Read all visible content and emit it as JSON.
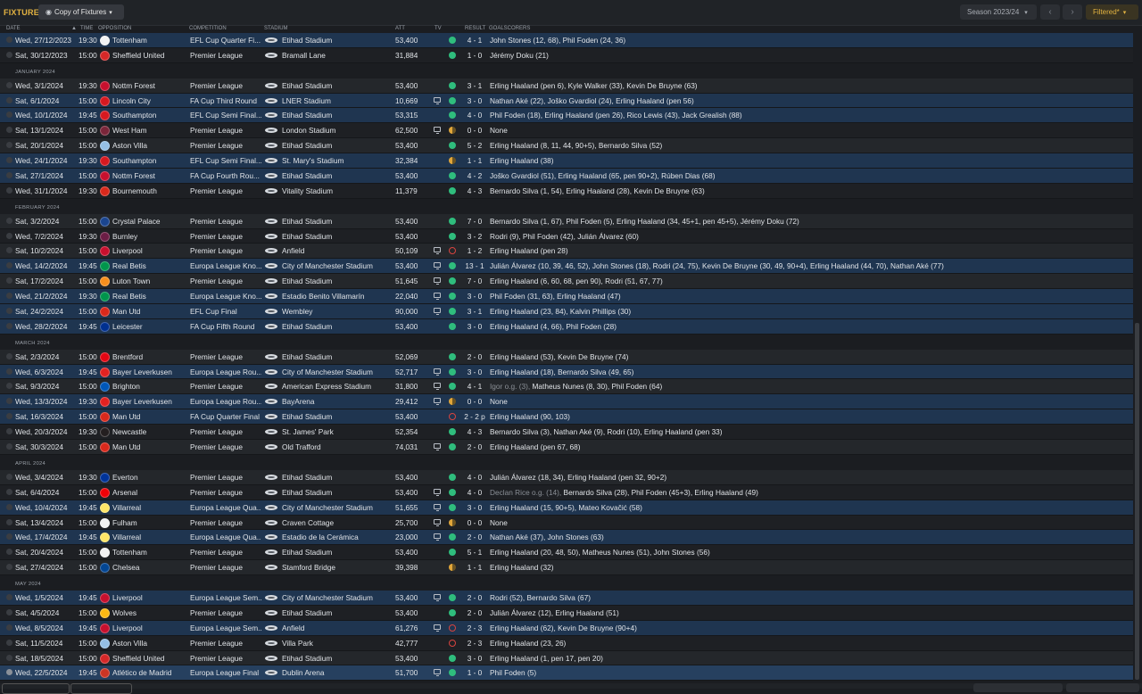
{
  "header": {
    "title": "FIXTURES",
    "view_button": "Copy of Fixtures",
    "season": "Season 2023/24",
    "filter_button": "Filtered*"
  },
  "columns": {
    "date": "DATE",
    "time": "TIME",
    "opposition": "OPPOSITION",
    "competition": "COMPETITION",
    "stadium": "STADIUM",
    "att": "ATT",
    "tv": "TV",
    "result": "RESULT",
    "goalscorers": "GOALSCORERS"
  },
  "colors": {
    "accent": "#e3b341",
    "win": "#2fbd7d",
    "loss": "#d9443f",
    "draw": "#e0a63a",
    "row_highlight": "#1f3550"
  },
  "rows": [
    {
      "type": "match",
      "date": "Wed, 27/12/2023",
      "time": "19:30",
      "opp": "Tottenham",
      "crest": "#f2f2f2",
      "comp": "EFL Cup Quarter Fi...",
      "stadium": "Etihad Stadium",
      "att": "53,400",
      "tv": false,
      "res": "win",
      "score": "4 - 1",
      "scorers": "John Stones (12, 68), Phil Foden (24, 36)",
      "hl": true
    },
    {
      "type": "match",
      "date": "Sat, 30/12/2023",
      "time": "15:00",
      "opp": "Sheffield United",
      "crest": "#d62828",
      "comp": "Premier League",
      "stadium": "Bramall Lane",
      "att": "31,884",
      "tv": false,
      "res": "win",
      "score": "1 - 0",
      "scorers": "Jérémy Doku (21)",
      "hl": false
    },
    {
      "type": "section",
      "label": "JANUARY 2024"
    },
    {
      "type": "match",
      "date": "Wed, 3/1/2024",
      "time": "19:30",
      "opp": "Nottm Forest",
      "crest": "#c8102e",
      "comp": "Premier League",
      "stadium": "Etihad Stadium",
      "att": "53,400",
      "tv": false,
      "res": "win",
      "score": "3 - 1",
      "scorers": "Erling Haaland (pen 6), Kyle Walker (33), Kevin De Bruyne (63)",
      "hl": false
    },
    {
      "type": "match",
      "date": "Sat, 6/1/2024",
      "time": "15:00",
      "opp": "Lincoln City",
      "crest": "#d71920",
      "comp": "FA Cup Third Round",
      "stadium": "LNER Stadium",
      "att": "10,669",
      "tv": true,
      "res": "win",
      "score": "3 - 0",
      "scorers": "Nathan Aké (22), Joško Gvardiol (24), Erling Haaland (pen 56)",
      "hl": true
    },
    {
      "type": "match",
      "date": "Wed, 10/1/2024",
      "time": "19:45",
      "opp": "Southampton",
      "crest": "#d71920",
      "comp": "EFL Cup Semi Final...",
      "stadium": "Etihad Stadium",
      "att": "53,315",
      "tv": false,
      "res": "win",
      "score": "4 - 0",
      "scorers": "Phil Foden (18), Erling Haaland (pen 26), Rico Lewis (43), Jack Grealish (88)",
      "hl": true
    },
    {
      "type": "match",
      "date": "Sat, 13/1/2024",
      "time": "15:00",
      "opp": "West Ham",
      "crest": "#7a263a",
      "comp": "Premier League",
      "stadium": "London Stadium",
      "att": "62,500",
      "tv": true,
      "res": "draw",
      "score": "0 - 0",
      "scorers": "None",
      "hl": false
    },
    {
      "type": "match",
      "date": "Sat, 20/1/2024",
      "time": "15:00",
      "opp": "Aston Villa",
      "crest": "#95bfe5",
      "comp": "Premier League",
      "stadium": "Etihad Stadium",
      "att": "53,400",
      "tv": false,
      "res": "win",
      "score": "5 - 2",
      "scorers": "Erling Haaland (8, 11, 44, 90+5), Bernardo Silva (52)",
      "hl": false
    },
    {
      "type": "match",
      "date": "Wed, 24/1/2024",
      "time": "19:30",
      "opp": "Southampton",
      "crest": "#d71920",
      "comp": "EFL Cup Semi Final...",
      "stadium": "St. Mary's Stadium",
      "att": "32,384",
      "tv": false,
      "res": "draw",
      "score": "1 - 1",
      "scorers": "Erling Haaland (38)",
      "hl": true
    },
    {
      "type": "match",
      "date": "Sat, 27/1/2024",
      "time": "15:00",
      "opp": "Nottm Forest",
      "crest": "#c8102e",
      "comp": "FA Cup Fourth Rou...",
      "stadium": "Etihad Stadium",
      "att": "53,400",
      "tv": false,
      "res": "win",
      "score": "4 - 2",
      "scorers": "Joško Gvardiol (51), Erling Haaland (65, pen 90+2), Rúben Dias (68)",
      "hl": true
    },
    {
      "type": "match",
      "date": "Wed, 31/1/2024",
      "time": "19:30",
      "opp": "Bournemouth",
      "crest": "#da291c",
      "comp": "Premier League",
      "stadium": "Vitality Stadium",
      "att": "11,379",
      "tv": false,
      "res": "win",
      "score": "4 - 3",
      "scorers": "Bernardo Silva (1, 54), Erling Haaland (28), Kevin De Bruyne (63)",
      "hl": false
    },
    {
      "type": "section",
      "label": "FEBRUARY 2024"
    },
    {
      "type": "match",
      "date": "Sat, 3/2/2024",
      "time": "15:00",
      "opp": "Crystal Palace",
      "crest": "#1b458f",
      "comp": "Premier League",
      "stadium": "Etihad Stadium",
      "att": "53,400",
      "tv": false,
      "res": "win",
      "score": "7 - 0",
      "scorers": "Bernardo Silva (1, 67), Phil Foden (5), Erling Haaland (34, 45+1, pen 45+5), Jérémy Doku (72)",
      "hl": false
    },
    {
      "type": "match",
      "date": "Wed, 7/2/2024",
      "time": "19:30",
      "opp": "Burnley",
      "crest": "#6c1d45",
      "comp": "Premier League",
      "stadium": "Etihad Stadium",
      "att": "53,400",
      "tv": false,
      "res": "win",
      "score": "3 - 2",
      "scorers": "Rodri (9), Phil Foden (42), Julián Álvarez (60)",
      "hl": false
    },
    {
      "type": "match",
      "date": "Sat, 10/2/2024",
      "time": "15:00",
      "opp": "Liverpool",
      "crest": "#c8102e",
      "comp": "Premier League",
      "stadium": "Anfield",
      "att": "50,109",
      "tv": true,
      "res": "loss",
      "score": "1 - 2",
      "scorers": "Erling Haaland (pen 28)",
      "hl": false
    },
    {
      "type": "match",
      "date": "Wed, 14/2/2024",
      "time": "19:45",
      "opp": "Real Betis",
      "crest": "#00954c",
      "comp": "Europa League Kno...",
      "stadium": "City of Manchester Stadium",
      "att": "53,400",
      "tv": true,
      "res": "win",
      "score": "13 - 1",
      "scorers": "Julián Álvarez (10, 39, 46, 52), John Stones (18), Rodri (24, 75), Kevin De Bruyne (30, 49, 90+4), Erling Haaland (44, 70), Nathan Aké (77)",
      "hl": true
    },
    {
      "type": "match",
      "date": "Sat, 17/2/2024",
      "time": "15:00",
      "opp": "Luton Town",
      "crest": "#f78f1e",
      "comp": "Premier League",
      "stadium": "Etihad Stadium",
      "att": "51,645",
      "tv": true,
      "res": "win",
      "score": "7 - 0",
      "scorers": "Erling Haaland (6, 60, 68, pen 90), Rodri (51, 67, 77)",
      "hl": false
    },
    {
      "type": "match",
      "date": "Wed, 21/2/2024",
      "time": "19:30",
      "opp": "Real Betis",
      "crest": "#00954c",
      "comp": "Europa League Kno...",
      "stadium": "Estadio Benito Villamarín",
      "att": "22,040",
      "tv": true,
      "res": "win",
      "score": "3 - 0",
      "scorers": "Phil Foden (31, 63), Erling Haaland (47)",
      "hl": true
    },
    {
      "type": "match",
      "date": "Sat, 24/2/2024",
      "time": "15:00",
      "opp": "Man Utd",
      "crest": "#da291c",
      "comp": "EFL Cup Final",
      "stadium": "Wembley",
      "att": "90,000",
      "tv": true,
      "res": "win",
      "score": "3 - 1",
      "scorers": "Erling Haaland (23, 84), Kalvin Phillips (30)",
      "hl": true
    },
    {
      "type": "match",
      "date": "Wed, 28/2/2024",
      "time": "19:45",
      "opp": "Leicester",
      "crest": "#003090",
      "comp": "FA Cup Fifth Round",
      "stadium": "Etihad Stadium",
      "att": "53,400",
      "tv": false,
      "res": "win",
      "score": "3 - 0",
      "scorers": "Erling Haaland (4, 66), Phil Foden (28)",
      "hl": true
    },
    {
      "type": "section",
      "label": "MARCH 2024"
    },
    {
      "type": "match",
      "date": "Sat, 2/3/2024",
      "time": "15:00",
      "opp": "Brentford",
      "crest": "#e30613",
      "comp": "Premier League",
      "stadium": "Etihad Stadium",
      "att": "52,069",
      "tv": false,
      "res": "win",
      "score": "2 - 0",
      "scorers": "Erling Haaland (53), Kevin De Bruyne (74)",
      "hl": false
    },
    {
      "type": "match",
      "date": "Wed, 6/3/2024",
      "time": "19:45",
      "opp": "Bayer Leverkusen",
      "crest": "#e32221",
      "comp": "Europa League Rou...",
      "stadium": "City of Manchester Stadium",
      "att": "52,717",
      "tv": true,
      "res": "win",
      "score": "3 - 0",
      "scorers": "Erling Haaland (18), Bernardo Silva (49, 65)",
      "hl": true
    },
    {
      "type": "match",
      "date": "Sat, 9/3/2024",
      "time": "15:00",
      "opp": "Brighton",
      "crest": "#0057b8",
      "comp": "Premier League",
      "stadium": "American Express Stadium",
      "att": "31,800",
      "tv": true,
      "res": "win",
      "score": "4 - 1",
      "og": "Igor o.g. (3), ",
      "scorers": "Matheus Nunes (8, 30), Phil Foden (64)",
      "hl": false
    },
    {
      "type": "match",
      "date": "Wed, 13/3/2024",
      "time": "19:30",
      "opp": "Bayer Leverkusen",
      "crest": "#e32221",
      "comp": "Europa League Rou...",
      "stadium": "BayArena",
      "att": "29,412",
      "tv": true,
      "res": "draw",
      "score": "0 - 0",
      "scorers": "None",
      "hl": true
    },
    {
      "type": "match",
      "date": "Sat, 16/3/2024",
      "time": "15:00",
      "opp": "Man Utd",
      "crest": "#da291c",
      "comp": "FA Cup Quarter Final",
      "stadium": "Etihad Stadium",
      "att": "53,400",
      "tv": false,
      "res": "loss",
      "score": "2 - 2 p",
      "scorers": "Erling Haaland (90, 103)",
      "hl": true
    },
    {
      "type": "match",
      "date": "Wed, 20/3/2024",
      "time": "19:30",
      "opp": "Newcastle",
      "crest": "#241f20",
      "comp": "Premier League",
      "stadium": "St. James' Park",
      "att": "52,354",
      "tv": false,
      "res": "win",
      "score": "4 - 3",
      "scorers": "Bernardo Silva (3), Nathan Aké (9), Rodri (10), Erling Haaland (pen 33)",
      "hl": false
    },
    {
      "type": "match",
      "date": "Sat, 30/3/2024",
      "time": "15:00",
      "opp": "Man Utd",
      "crest": "#da291c",
      "comp": "Premier League",
      "stadium": "Old Trafford",
      "att": "74,031",
      "tv": true,
      "res": "win",
      "score": "2 - 0",
      "scorers": "Erling Haaland (pen 67, 68)",
      "hl": false
    },
    {
      "type": "section",
      "label": "APRIL 2024"
    },
    {
      "type": "match",
      "date": "Wed, 3/4/2024",
      "time": "19:30",
      "opp": "Everton",
      "crest": "#003399",
      "comp": "Premier League",
      "stadium": "Etihad Stadium",
      "att": "53,400",
      "tv": false,
      "res": "win",
      "score": "4 - 0",
      "scorers": "Julián Álvarez (18, 34), Erling Haaland (pen 32, 90+2)",
      "hl": false
    },
    {
      "type": "match",
      "date": "Sat, 6/4/2024",
      "time": "15:00",
      "opp": "Arsenal",
      "crest": "#ef0107",
      "comp": "Premier League",
      "stadium": "Etihad Stadium",
      "att": "53,400",
      "tv": true,
      "res": "win",
      "score": "4 - 0",
      "og": "Declan Rice o.g. (14), ",
      "scorers": "Bernardo Silva (28), Phil Foden (45+3), Erling Haaland (49)",
      "hl": false
    },
    {
      "type": "match",
      "date": "Wed, 10/4/2024",
      "time": "19:45",
      "opp": "Villarreal",
      "crest": "#ffe667",
      "comp": "Europa League Qua...",
      "stadium": "City of Manchester Stadium",
      "att": "51,655",
      "tv": true,
      "res": "win",
      "score": "3 - 0",
      "scorers": "Erling Haaland (15, 90+5), Mateo Kovačić (58)",
      "hl": true
    },
    {
      "type": "match",
      "date": "Sat, 13/4/2024",
      "time": "15:00",
      "opp": "Fulham",
      "crest": "#f2f2f2",
      "comp": "Premier League",
      "stadium": "Craven Cottage",
      "att": "25,700",
      "tv": true,
      "res": "draw",
      "score": "0 - 0",
      "scorers": "None",
      "hl": false
    },
    {
      "type": "match",
      "date": "Wed, 17/4/2024",
      "time": "19:45",
      "opp": "Villarreal",
      "crest": "#ffe667",
      "comp": "Europa League Qua...",
      "stadium": "Estadio de la Cerámica",
      "att": "23,000",
      "tv": true,
      "res": "win",
      "score": "2 - 0",
      "scorers": "Nathan Aké (37), John Stones (63)",
      "hl": true
    },
    {
      "type": "match",
      "date": "Sat, 20/4/2024",
      "time": "15:00",
      "opp": "Tottenham",
      "crest": "#f2f2f2",
      "comp": "Premier League",
      "stadium": "Etihad Stadium",
      "att": "53,400",
      "tv": false,
      "res": "win",
      "score": "5 - 1",
      "scorers": "Erling Haaland (20, 48, 50), Matheus Nunes (51), John Stones (56)",
      "hl": false
    },
    {
      "type": "match",
      "date": "Sat, 27/4/2024",
      "time": "15:00",
      "opp": "Chelsea",
      "crest": "#034694",
      "comp": "Premier League",
      "stadium": "Stamford Bridge",
      "att": "39,398",
      "tv": false,
      "res": "draw",
      "score": "1 - 1",
      "scorers": "Erling Haaland (32)",
      "hl": false
    },
    {
      "type": "section",
      "label": "MAY 2024"
    },
    {
      "type": "match",
      "date": "Wed, 1/5/2024",
      "time": "19:45",
      "opp": "Liverpool",
      "crest": "#c8102e",
      "comp": "Europa League Sem...",
      "stadium": "City of Manchester Stadium",
      "att": "53,400",
      "tv": true,
      "res": "win",
      "score": "2 - 0",
      "scorers": "Rodri (52), Bernardo Silva (67)",
      "hl": true
    },
    {
      "type": "match",
      "date": "Sat, 4/5/2024",
      "time": "15:00",
      "opp": "Wolves",
      "crest": "#fdb913",
      "comp": "Premier League",
      "stadium": "Etihad Stadium",
      "att": "53,400",
      "tv": false,
      "res": "win",
      "score": "2 - 0",
      "scorers": "Julián Álvarez (12), Erling Haaland (51)",
      "hl": false
    },
    {
      "type": "match",
      "date": "Wed, 8/5/2024",
      "time": "19:45",
      "opp": "Liverpool",
      "crest": "#c8102e",
      "comp": "Europa League Sem...",
      "stadium": "Anfield",
      "att": "61,276",
      "tv": true,
      "res": "loss",
      "score": "2 - 3",
      "scorers": "Erling Haaland (62), Kevin De Bruyne (90+4)",
      "hl": true
    },
    {
      "type": "match",
      "date": "Sat, 11/5/2024",
      "time": "15:00",
      "opp": "Aston Villa",
      "crest": "#95bfe5",
      "comp": "Premier League",
      "stadium": "Villa Park",
      "att": "42,777",
      "tv": false,
      "res": "loss",
      "score": "2 - 3",
      "scorers": "Erling Haaland (23, 26)",
      "hl": false
    },
    {
      "type": "match",
      "date": "Sat, 18/5/2024",
      "time": "15:00",
      "opp": "Sheffield United",
      "crest": "#d62828",
      "comp": "Premier League",
      "stadium": "Etihad Stadium",
      "att": "53,400",
      "tv": false,
      "res": "win",
      "score": "3 - 0",
      "scorers": "Erling Haaland (1, pen 17, pen 20)",
      "hl": false
    },
    {
      "type": "match",
      "date": "Wed, 22/5/2024",
      "time": "19:45",
      "opp": "Atlético de Madrid",
      "crest": "#cb3524",
      "comp": "Europa League Final",
      "stadium": "Dublin Arena",
      "att": "51,700",
      "tv": true,
      "res": "win",
      "score": "1 - 0",
      "scorers": "Phil Foden (5)",
      "hl": true,
      "selected": true
    }
  ]
}
